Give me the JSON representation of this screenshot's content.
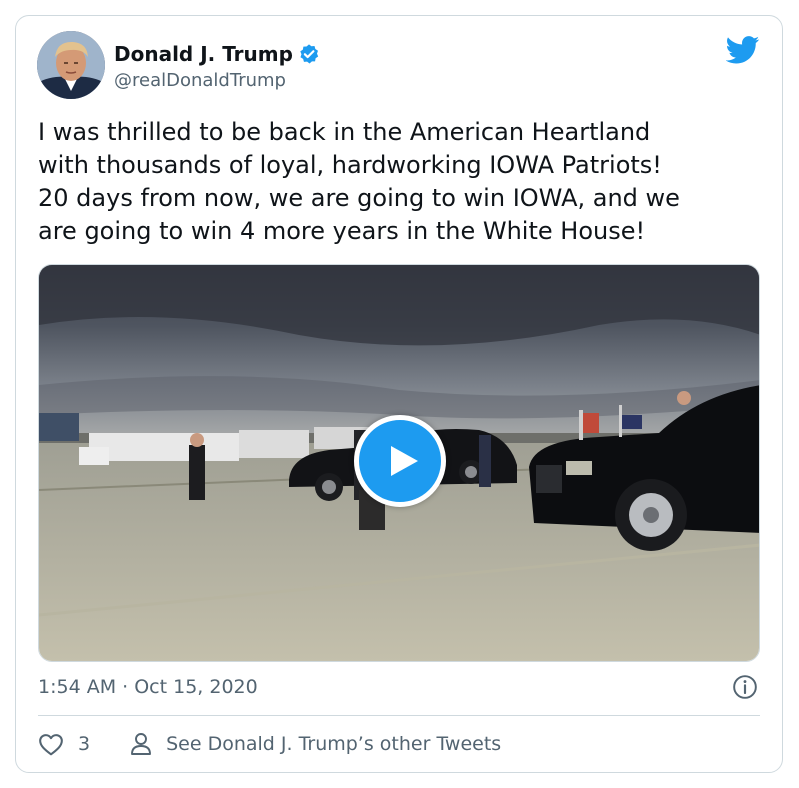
{
  "author": {
    "name": "Donald J. Trump",
    "handle": "@realDonaldTrump",
    "avatar_icon": "profile-photo",
    "verified_icon": "verified-badge-icon"
  },
  "brand": {
    "icon": "twitter-bird-icon",
    "color": "#1d9bf0"
  },
  "tweet": {
    "text": "I was thrilled to be back in the American Heartland\nwith thousands of loyal, hardworking IOWA Patriots!\n20 days from now, we are going to win IOWA, and we\nare going to win 4 more years in the White House!"
  },
  "media": {
    "type": "video",
    "play_icon": "play-icon"
  },
  "meta": {
    "timestamp": "1:54 AM · Oct 15, 2020",
    "info_icon": "info-icon"
  },
  "actions": {
    "like_icon": "heart-icon",
    "like_count": "3",
    "other_tweets_icon": "person-icon",
    "other_tweets_label": "See Donald J. Trump’s other Tweets"
  },
  "colors": {
    "text": "#0f1419",
    "secondary": "#536471",
    "border": "#cfd9de"
  }
}
